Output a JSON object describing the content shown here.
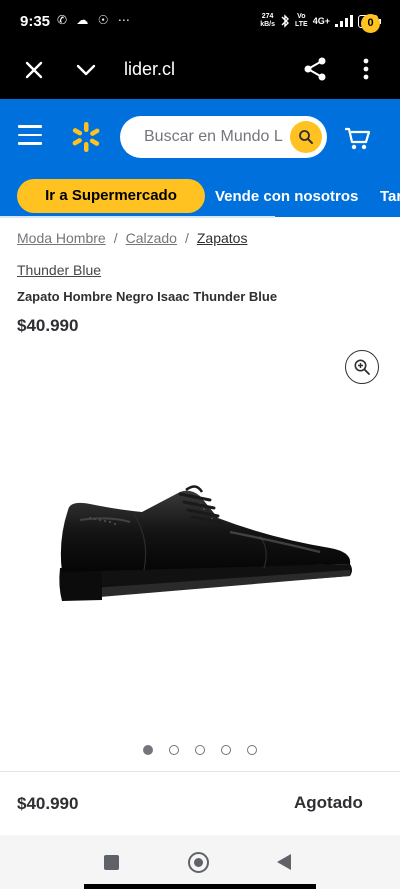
{
  "status_bar": {
    "time": "9:35",
    "left_icons": "✆ ☁ ☉ ⋯",
    "net_speed_value": "274",
    "net_speed_unit": "kB/s",
    "volte_top": "Vo",
    "volte_bottom": "LTE",
    "signal": "4G+",
    "battery": "69"
  },
  "browser": {
    "url": "lider.cl"
  },
  "header": {
    "search_placeholder": "Buscar en Mundo L",
    "cart_count": "0"
  },
  "nav_strip": {
    "pill_label": "Ir a Supermercado",
    "link_1": "Vende con nosotros",
    "link_2": "Tar"
  },
  "breadcrumb": {
    "items": [
      "Moda Hombre",
      "Calzado",
      "Zapatos"
    ],
    "separator": "/"
  },
  "product": {
    "brand": "Thunder Blue",
    "title": "Zapato Hombre Negro Isaac Thunder Blue",
    "price": "$40.990",
    "image_count": 5,
    "active_image_index": 0
  },
  "footer_bar": {
    "price": "$40.990",
    "status": "Agotado"
  },
  "colors": {
    "brand_blue": "#0071dc",
    "brand_yellow": "#ffc220"
  },
  "icons": [
    "close-icon",
    "chevron-down-icon",
    "share-icon",
    "kebab-menu-icon",
    "hamburger-icon",
    "walmart-spark-icon",
    "search-icon",
    "cart-icon",
    "zoom-icon"
  ]
}
